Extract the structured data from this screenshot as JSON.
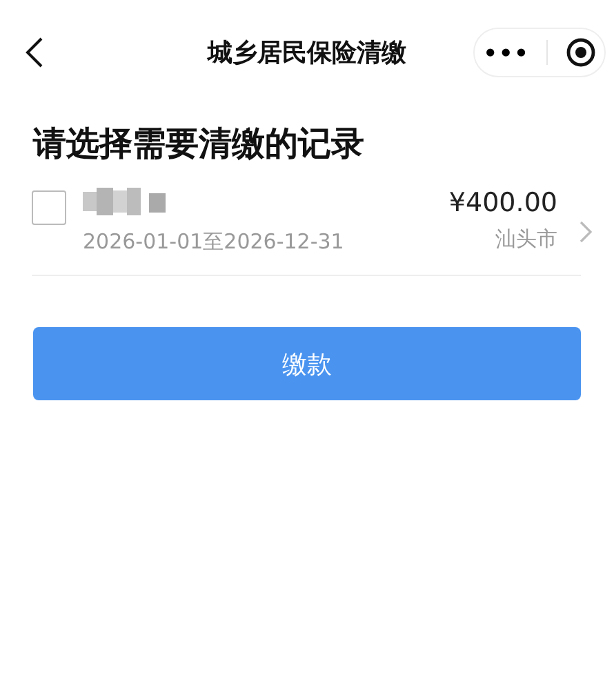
{
  "nav": {
    "title": "城乡居民保险清缴",
    "more": "•••"
  },
  "heading": "请选择需要清缴的记录",
  "records": [
    {
      "checked": false,
      "amount": "¥400.00",
      "period": "2026-01-01至2026-12-31",
      "city": "汕头市"
    }
  ],
  "pay_button": "缴款"
}
